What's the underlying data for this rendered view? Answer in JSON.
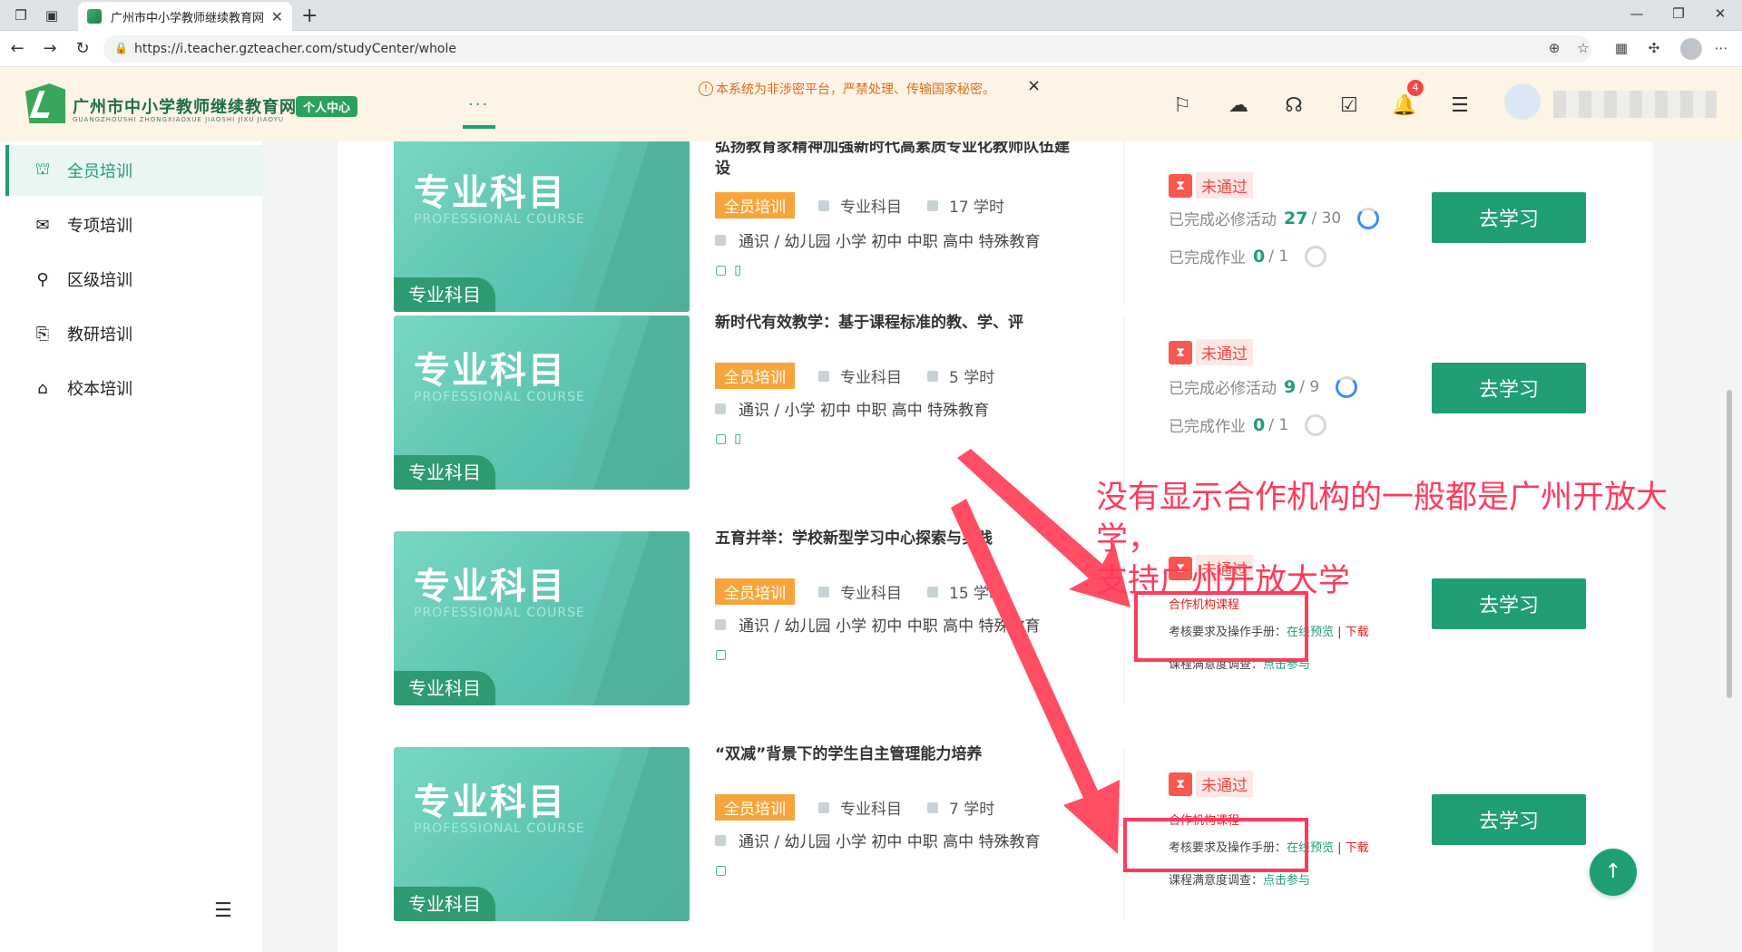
{
  "browser": {
    "tab_title": "广州市中小学教师继续教育网",
    "url": "https://i.teacher.gzteacher.com/studyCenter/whole"
  },
  "header": {
    "logo_title": "广州市中小学教师继续教育网",
    "logo_subtitle": "GUANGZHOUSHI ZHONGXIAOXUE JIAOSHI JIXU JIAOYU",
    "logo_badge": "个人中心",
    "nav_more": "...",
    "notice": "本系统为非涉密平台，严禁处理、传输国家秘密。",
    "notice_close": "×",
    "bell_count": "4"
  },
  "sidebar": {
    "items": [
      {
        "label": "全员培训",
        "icon": "training-icon"
      },
      {
        "label": "专项培训",
        "icon": "mail-icon"
      },
      {
        "label": "区级培训",
        "icon": "district-icon"
      },
      {
        "label": "教研培训",
        "icon": "research-icon"
      },
      {
        "label": "校本培训",
        "icon": "school-icon"
      }
    ]
  },
  "thumb": {
    "big": "专业科目",
    "en": "PROFESSIONAL COURSE",
    "tag": "专业科目"
  },
  "courses": [
    {
      "title": "弘扬教育家精神加强新时代高素质专业化教师队伍建设",
      "type": "全员培训",
      "subject": "专业科目",
      "hours": "17 学时",
      "targets": "通识 / 幼儿园 小学 初中 中职 高中 特殊教育",
      "status": "未通过",
      "act_label": "已完成必修活动",
      "act_done": "27",
      "act_total": "/ 30",
      "hw_label": "已完成作业",
      "hw_done": "0",
      "hw_total": "/ 1",
      "button": "去学习"
    },
    {
      "title": "新时代有效教学：基于课程标准的教、学、评",
      "type": "全员培训",
      "subject": "专业科目",
      "hours": "5 学时",
      "targets": "通识 / 小学 初中 中职 高中 特殊教育",
      "status": "未通过",
      "act_label": "已完成必修活动",
      "act_done": "9",
      "act_total": "/ 9",
      "hw_label": "已完成作业",
      "hw_done": "0",
      "hw_total": "/ 1",
      "button": "去学习"
    },
    {
      "title": "五育并举：学校新型学习中心探索与实践",
      "type": "全员培训",
      "subject": "专业科目",
      "hours": "15 学时",
      "targets": "通识 / 幼儿园 小学 初中 中职 高中 特殊教育",
      "status": "未通过",
      "partner": "合作机构课程",
      "req_label": "考核要求及操作手册：",
      "req_preview": "在线预览",
      "req_sep": "|",
      "req_download": "下载",
      "survey_label": "课程满意度调查：",
      "survey_link": "点击参与",
      "button": "去学习"
    },
    {
      "title": "“双减”背景下的学生自主管理能力培养",
      "type": "全员培训",
      "subject": "专业科目",
      "hours": "7 学时",
      "targets": "通识 / 幼儿园 小学 初中 中职 高中 特殊教育",
      "status": "未通过",
      "partner": "合作机构课程",
      "req_label": "考核要求及操作手册：",
      "req_preview": "在线预览",
      "req_sep": "|",
      "req_download": "下载",
      "survey_label": "课程满意度调查：",
      "survey_link": "点击参与",
      "button": "去学习"
    }
  ],
  "annotation": {
    "line1": "没有显示合作机构的一般都是广州开放大学，",
    "line2": "支持广州开放大学"
  },
  "colors": {
    "accent": "#1f9e76",
    "orange": "#f7a53a",
    "alert": "#ff3b5c"
  }
}
